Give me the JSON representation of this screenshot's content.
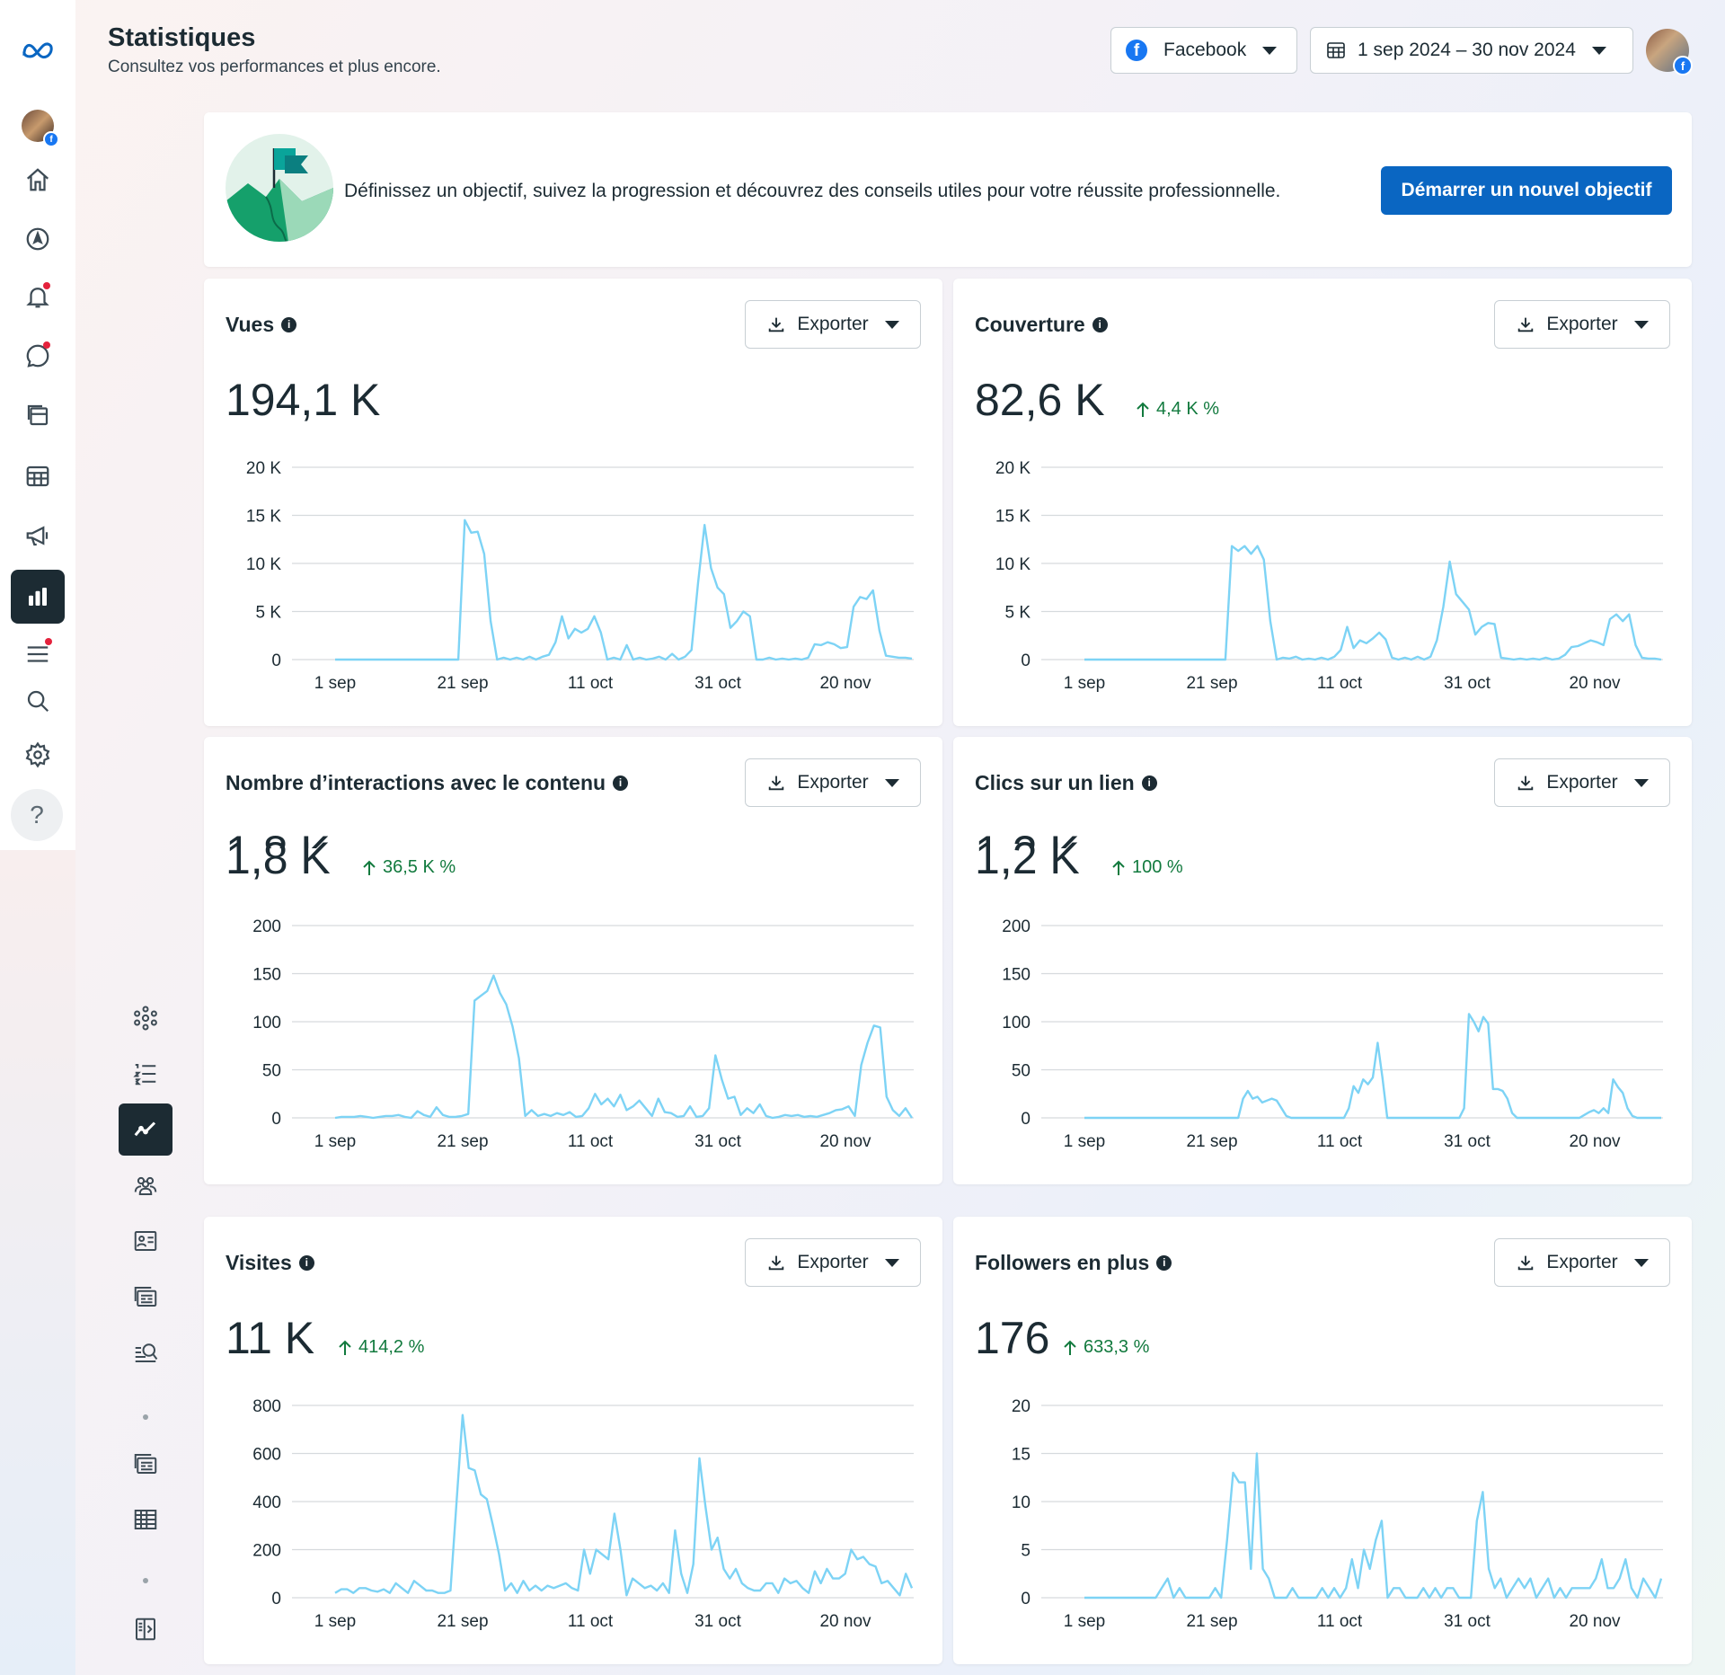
{
  "header": {
    "title": "Statistiques",
    "subtitle": "Consultez vos performances et plus encore.",
    "platform_label": "Facebook",
    "date_range_label": "1 sep 2024 – 30 nov 2024"
  },
  "goal": {
    "text": "Définissez un objectif, suivez la progression et découvrez des conseils utiles pour votre réussite professionnelle.",
    "button_label": "Démarrer un nouvel objectif"
  },
  "export_label": "Exporter",
  "colors": {
    "line": "#7dd3f5",
    "accent": "#0a66c2",
    "positive": "#127a3e",
    "grid": "#d6dadd"
  },
  "x_ticks": [
    "1 sep",
    "21 sep",
    "11 oct",
    "31 oct",
    "20 nov"
  ],
  "icons": {
    "rail": [
      "meta-logo-icon",
      "profile-avatar-icon",
      "home-icon",
      "compass-icon",
      "notifications-icon",
      "messages-icon",
      "content-icon",
      "planner-icon",
      "ads-icon",
      "insights-icon",
      "all-tools-icon",
      "search-icon",
      "settings-icon",
      "help-icon"
    ],
    "insights_nav": [
      "overview-icon",
      "results-icon",
      "trends-icon",
      "audience-icon",
      "content-icon",
      "ads-insights-icon",
      "benchmarking-icon",
      "reports-icon",
      "export-table-icon",
      "collapse-panel-icon"
    ]
  },
  "metrics": [
    {
      "title": "Vues",
      "value": "194,1 K",
      "delta": ""
    },
    {
      "title": "Couverture",
      "value": "82,6 K",
      "delta": "4,4 K %"
    },
    {
      "title": "Nombre d’interactions avec le contenu",
      "value": "1,8 K",
      "ghost": "1,8 K",
      "delta": "36,5 K %"
    },
    {
      "title": "Clics sur un lien",
      "value": "1,2 K",
      "ghost": "1,2 K",
      "delta": "100 %"
    },
    {
      "title": "Visites",
      "value": "11 K",
      "delta": "414,2 %"
    },
    {
      "title": "Followers en plus",
      "value": "176",
      "delta": "633,3 %"
    }
  ],
  "chart_data": [
    {
      "type": "line",
      "title": "Vues",
      "x_start": "1 sep",
      "x_end": "30 nov",
      "x_ticks": [
        "1 sep",
        "21 sep",
        "11 oct",
        "31 oct",
        "20 nov"
      ],
      "y_ticks": [
        "0",
        "5 K",
        "10 K",
        "15 K",
        "20 K"
      ],
      "ylim": [
        0,
        20000
      ],
      "series": [
        {
          "values": [
            0,
            0,
            0,
            0,
            0,
            0,
            0,
            0,
            0,
            0,
            0,
            0,
            0,
            0,
            0,
            0,
            0,
            0,
            0,
            0,
            14500,
            13200,
            13300,
            11000,
            4000,
            0,
            200,
            0,
            200,
            0,
            300,
            0,
            300,
            500,
            1800,
            4500,
            2200,
            3200,
            2800,
            3200,
            4500,
            2800,
            0,
            200,
            0,
            1500,
            0,
            200,
            0,
            100,
            300,
            0,
            600,
            0,
            300,
            1000,
            8000,
            14000,
            9500,
            7500,
            6800,
            3300,
            4000,
            5000,
            4500,
            0,
            0,
            200,
            0,
            100,
            0,
            100,
            0,
            200,
            1600,
            1500,
            1800,
            1600,
            1200,
            1300,
            5500,
            6500,
            6300,
            7200,
            3000,
            400,
            300,
            200,
            200,
            100
          ]
        }
      ]
    },
    {
      "type": "line",
      "title": "Couverture",
      "x_start": "1 sep",
      "x_end": "30 nov",
      "x_ticks": [
        "1 sep",
        "21 sep",
        "11 oct",
        "31 oct",
        "20 nov"
      ],
      "y_ticks": [
        "0",
        "5 K",
        "10 K",
        "15 K",
        "20 K"
      ],
      "ylim": [
        0,
        20000
      ],
      "series": [
        {
          "values": [
            0,
            0,
            0,
            0,
            0,
            0,
            0,
            0,
            0,
            0,
            0,
            0,
            0,
            0,
            0,
            0,
            0,
            0,
            0,
            0,
            0,
            0,
            0,
            11800,
            11300,
            11800,
            11000,
            11800,
            10400,
            4000,
            0,
            200,
            100,
            300,
            0,
            100,
            0,
            200,
            0,
            300,
            1000,
            3400,
            1200,
            2000,
            1700,
            2200,
            2800,
            2100,
            200,
            0,
            200,
            0,
            300,
            0,
            300,
            2000,
            5500,
            10200,
            6800,
            6000,
            5200,
            2600,
            3400,
            3800,
            3700,
            200,
            100,
            0,
            100,
            0,
            100,
            0,
            200,
            0,
            100,
            500,
            1300,
            1400,
            1700,
            2000,
            1800,
            1500,
            4200,
            4700,
            4000,
            4700,
            1500,
            200,
            100,
            100,
            0
          ]
        }
      ]
    },
    {
      "type": "line",
      "title": "Nombre d’interactions avec le contenu",
      "x_start": "1 sep",
      "x_end": "30 nov",
      "x_ticks": [
        "1 sep",
        "21 sep",
        "11 oct",
        "31 oct",
        "20 nov"
      ],
      "y_ticks": [
        "0",
        "50",
        "100",
        "150",
        "200"
      ],
      "ylim": [
        0,
        200
      ],
      "series": [
        {
          "values": [
            0,
            1,
            1,
            1,
            2,
            1,
            0,
            1,
            2,
            2,
            3,
            1,
            0,
            7,
            3,
            1,
            11,
            3,
            1,
            1,
            2,
            4,
            122,
            127,
            132,
            148,
            130,
            118,
            95,
            62,
            2,
            8,
            2,
            4,
            2,
            5,
            3,
            6,
            1,
            2,
            10,
            25,
            14,
            20,
            12,
            24,
            8,
            12,
            18,
            10,
            2,
            20,
            6,
            5,
            1,
            2,
            12,
            1,
            2,
            10,
            65,
            40,
            20,
            22,
            3,
            10,
            5,
            14,
            2,
            0,
            1,
            3,
            2,
            3,
            1,
            2,
            1,
            3,
            5,
            8,
            9,
            12,
            2,
            55,
            78,
            96,
            94,
            22,
            8,
            2,
            10,
            0
          ]
        }
      ]
    },
    {
      "type": "line",
      "title": "Clics sur un lien",
      "x_start": "1 sep",
      "x_end": "30 nov",
      "x_ticks": [
        "1 sep",
        "21 sep",
        "11 oct",
        "31 oct",
        "20 nov"
      ],
      "y_ticks": [
        "0",
        "50",
        "100",
        "150",
        "200"
      ],
      "ylim": [
        0,
        200
      ],
      "series": [
        {
          "values": [
            0,
            0,
            0,
            0,
            0,
            0,
            0,
            0,
            0,
            0,
            0,
            0,
            0,
            0,
            0,
            0,
            0,
            0,
            0,
            0,
            0,
            0,
            0,
            0,
            0,
            0,
            0,
            0,
            0,
            0,
            0,
            0,
            0,
            20,
            28,
            20,
            22,
            16,
            18,
            20,
            18,
            10,
            2,
            0,
            0,
            0,
            0,
            0,
            0,
            0,
            0,
            0,
            0,
            0,
            0,
            10,
            33,
            26,
            40,
            35,
            42,
            78,
            42,
            0,
            0,
            0,
            0,
            0,
            0,
            0,
            0,
            0,
            0,
            0,
            0,
            0,
            0,
            0,
            0,
            10,
            108,
            100,
            90,
            105,
            98,
            30,
            30,
            28,
            20,
            5,
            0,
            0,
            0,
            0,
            0,
            0,
            0,
            0,
            0,
            0,
            0,
            0,
            0,
            0,
            3,
            6,
            8,
            5,
            10,
            5,
            40,
            32,
            26,
            10,
            2,
            0,
            0,
            0,
            0,
            0,
            0
          ]
        }
      ]
    },
    {
      "type": "line",
      "title": "Visites",
      "x_start": "1 sep",
      "x_end": "30 nov",
      "x_ticks": [
        "1 sep",
        "21 sep",
        "11 oct",
        "31 oct",
        "20 nov"
      ],
      "y_ticks": [
        "0",
        "200",
        "400",
        "600",
        "800"
      ],
      "ylim": [
        0,
        800
      ],
      "series": [
        {
          "values": [
            20,
            35,
            35,
            20,
            40,
            40,
            30,
            25,
            35,
            20,
            60,
            40,
            20,
            70,
            50,
            30,
            30,
            20,
            20,
            30,
            400,
            760,
            540,
            530,
            430,
            410,
            300,
            180,
            30,
            60,
            20,
            70,
            30,
            50,
            30,
            50,
            40,
            50,
            60,
            40,
            30,
            200,
            100,
            200,
            180,
            160,
            350,
            200,
            10,
            80,
            60,
            40,
            50,
            30,
            60,
            20,
            280,
            100,
            20,
            140,
            580,
            380,
            200,
            250,
            120,
            80,
            120,
            60,
            40,
            30,
            30,
            60,
            60,
            20,
            80,
            60,
            70,
            40,
            20,
            110,
            60,
            120,
            80,
            80,
            100,
            200,
            160,
            170,
            140,
            130,
            60,
            70,
            40,
            10,
            100,
            40
          ]
        }
      ]
    },
    {
      "type": "line",
      "title": "Followers en plus",
      "x_start": "1 sep",
      "x_end": "30 nov",
      "x_ticks": [
        "1 sep",
        "21 sep",
        "11 oct",
        "31 oct",
        "20 nov"
      ],
      "y_ticks": [
        "0",
        "5",
        "10",
        "15",
        "20"
      ],
      "ylim": [
        0,
        20
      ],
      "series": [
        {
          "values": [
            0,
            0,
            0,
            0,
            0,
            0,
            0,
            0,
            0,
            0,
            0,
            0,
            0,
            1,
            2,
            0,
            1,
            0,
            0,
            0,
            0,
            0,
            1,
            0,
            6,
            13,
            12,
            12,
            3,
            15,
            3,
            2,
            0,
            0,
            0,
            1,
            0,
            0,
            0,
            0,
            1,
            0,
            1,
            0,
            1,
            4,
            1,
            5,
            3,
            6,
            8,
            0,
            1,
            1,
            0,
            0,
            0,
            1,
            0,
            1,
            0,
            1,
            1,
            0,
            0,
            0,
            8,
            11,
            3,
            1,
            2,
            0,
            1,
            2,
            1,
            2,
            0,
            1,
            2,
            0,
            1,
            0,
            1,
            1,
            1,
            1,
            2,
            4,
            1,
            1,
            2,
            4,
            1,
            0,
            2,
            1,
            0,
            2
          ]
        }
      ]
    }
  ]
}
